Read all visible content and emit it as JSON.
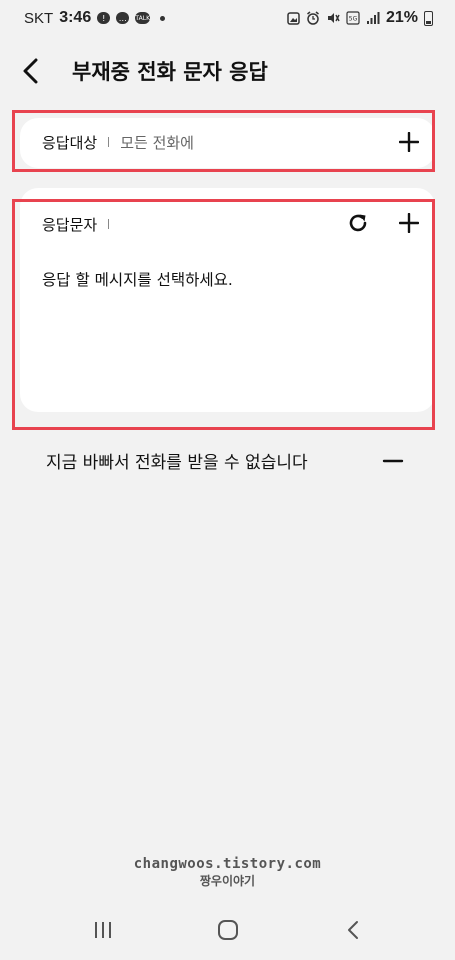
{
  "status_bar": {
    "carrier": "SKT",
    "time": "3:46",
    "battery_percent": "21%",
    "icons": [
      "alert-bubble-icon",
      "chat-bubble-icon",
      "talk-bubble-icon",
      "dot-icon",
      "photo-icon",
      "alarm-icon",
      "mute-icon",
      "volte-icon",
      "signal-icon",
      "battery-icon"
    ]
  },
  "header": {
    "title": "부재중 전화 문자 응답",
    "back_icon": "back-arrow-icon"
  },
  "target": {
    "label": "응답대상",
    "value": "모든 전화에",
    "add_icon": "plus-icon"
  },
  "message": {
    "label": "응답문자",
    "placeholder": "응답 할 메시지를 선택하세요.",
    "refresh_icon": "refresh-icon",
    "add_icon": "plus-icon"
  },
  "saved_messages": [
    {
      "text": "지금 바빠서 전화를 받을 수 없습니다",
      "remove_icon": "minus-icon"
    }
  ],
  "watermark": {
    "line1": "changwoos.tistory.com",
    "line2": "짱우이야기"
  },
  "nav": {
    "recents_icon": "recents-icon",
    "home_icon": "home-icon",
    "back_icon": "nav-back-icon"
  },
  "colors": {
    "background": "#f2f2f2",
    "card": "#ffffff",
    "highlight": "#e8434f",
    "text": "#111111",
    "secondary_text": "#666666"
  }
}
